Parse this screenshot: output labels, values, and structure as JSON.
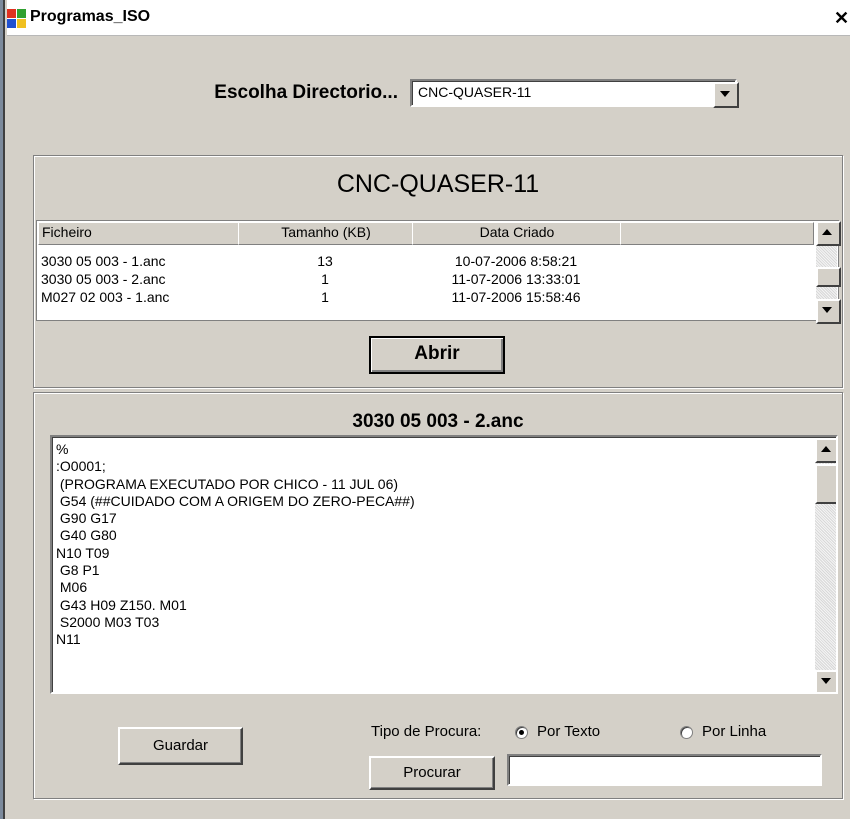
{
  "window": {
    "title": "Programas_ISO",
    "close_glyph": "✕"
  },
  "directory": {
    "label": "Escolha Directorio...",
    "selected": "CNC-QUASER-11",
    "heading": "CNC-QUASER-11"
  },
  "file_list": {
    "columns": [
      "Ficheiro",
      "Tamanho (KB)",
      "Data Criado"
    ],
    "rows": [
      [
        "3030 05 003 - 1.anc",
        "13",
        "10-07-2006 8:58:21"
      ],
      [
        "3030 05 003 - 2.anc",
        "1",
        "11-07-2006 13:33:01"
      ],
      [
        "M027 02 003 - 1.anc",
        "1",
        "11-07-2006 15:58:46"
      ]
    ]
  },
  "open_button": "Abrir",
  "file_view": {
    "heading": "3030 05 003 - 2.anc",
    "lines": [
      "%",
      ":O0001;",
      " (PROGRAMA EXECUTADO POR CHICO - 11 JUL 06)",
      " G54 (##CUIDADO COM A ORIGEM DO ZERO-PECA##)",
      " G90 G17",
      " G40 G80",
      "N10 T09",
      " G8 P1",
      " M06",
      " G43 H09 Z150. M01",
      " S2000 M03 T03",
      "N11"
    ]
  },
  "save_button": "Guardar",
  "search": {
    "type_label": "Tipo de Procura:",
    "option_text": "Por Texto",
    "option_line": "Por Linha",
    "selected": "Por Texto",
    "button": "Procurar",
    "value": ""
  },
  "icons": {
    "app": "app-window-icon",
    "close": "close-icon",
    "dropdown": "chevron-down-icon",
    "scroll_up": "scroll-up-arrow-icon",
    "scroll_down": "scroll-down-arrow-icon"
  }
}
